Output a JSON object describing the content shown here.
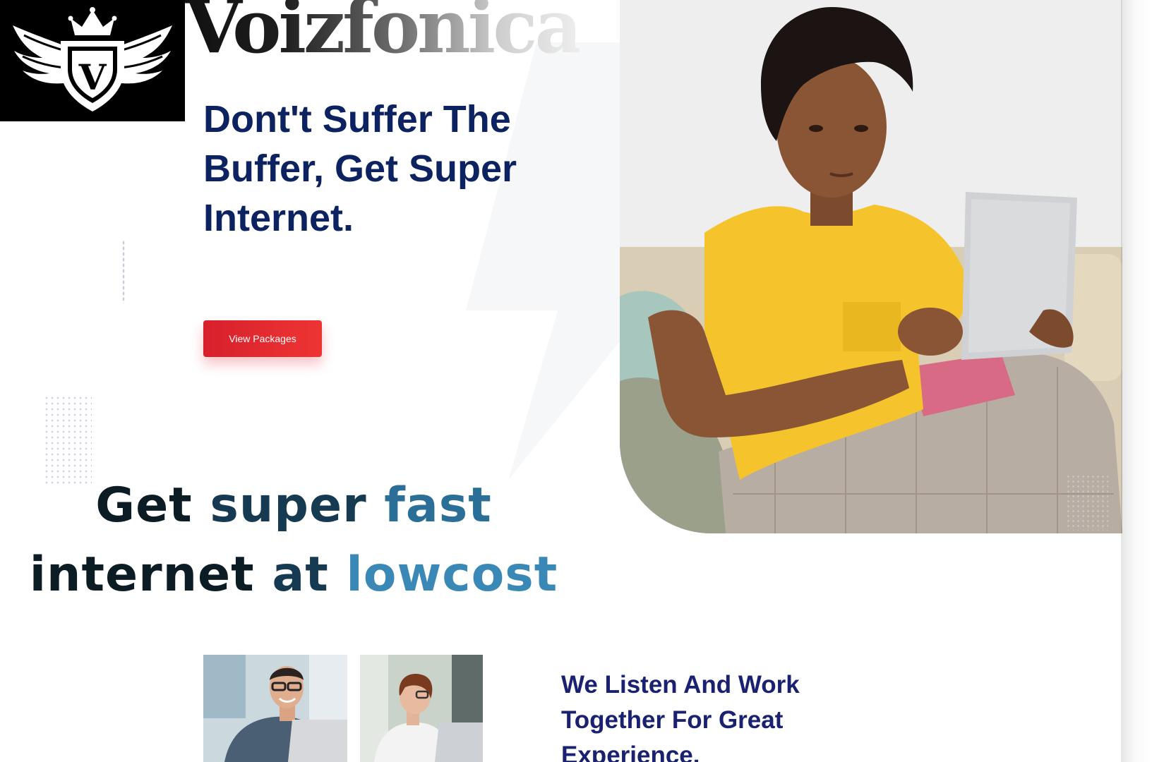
{
  "brand": {
    "name": "Voizfonica",
    "logo_letter": "V",
    "logo_icon": "winged-shield-crown-icon"
  },
  "hero": {
    "headline": "Dont't Suffer The Buffer, Get Super Internet.",
    "cta_label": "View Packages",
    "photo": "teen-with-tablet-on-sofa-photo"
  },
  "promo": {
    "words": [
      {
        "text": "Get",
        "tone": "dark"
      },
      {
        "text": "super",
        "tone": "mid"
      },
      {
        "text": "fast",
        "tone": "blue"
      },
      {
        "text": "internet",
        "tone": "dark"
      },
      {
        "text": "at",
        "tone": "mid"
      },
      {
        "text": "lowcost",
        "tone": "blue2"
      }
    ]
  },
  "team": {
    "photo_1": "man-with-laptop-photo",
    "photo_2": "woman-with-laptop-photo"
  },
  "section_heading": "We Listen And Work Together For Great Experience.",
  "colors": {
    "navy": "#0d2260",
    "cta_red": "#e62b30",
    "promo_dark": "#0b1c25",
    "promo_blue": "#2b6f98",
    "heading_indigo": "#1a2170"
  }
}
